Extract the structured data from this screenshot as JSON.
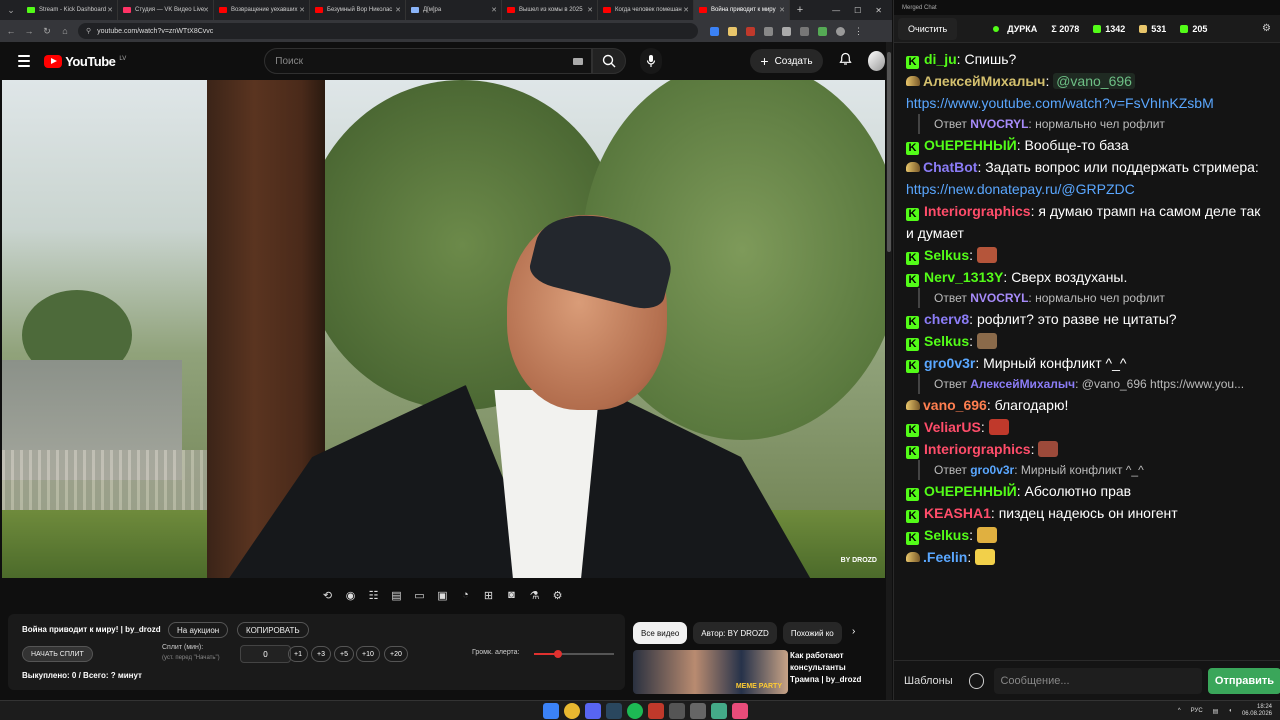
{
  "browser": {
    "tabs": [
      {
        "label": "Stream - Kick Dashboard",
        "color": "#53fc18"
      },
      {
        "label": "Студия — VK Видео Live",
        "color": "#ff3366"
      },
      {
        "label": "Возвращение уехавших",
        "color": "#ff0000"
      },
      {
        "label": "Безумный Вор Николас",
        "color": "#ff0000"
      },
      {
        "label": "Д[м]ра",
        "color": "#8ab4f8"
      },
      {
        "label": "Вышел из комы в 2025",
        "color": "#ff0000"
      },
      {
        "label": "Когда человек помешан",
        "color": "#ff0000"
      },
      {
        "label": "Война приводит к миру",
        "color": "#ff0000",
        "active": true
      }
    ],
    "url": "youtube.com/watch?v=znWTtX8Cvvc"
  },
  "youtube": {
    "logo_text": "YouTube",
    "region": "LV",
    "search_placeholder": "Поиск",
    "create_label": "Создать"
  },
  "player_panel": {
    "title": "Война приводит к миру! | by_drozd",
    "auction_label": "На аукцион",
    "copy_label": "КОПИРОВАТЬ",
    "start_split_label": "НАЧАТЬ СПЛИТ",
    "split_label": "Сплит (мин):",
    "split_hint": "(уст. перед \"Начать\")",
    "split_value": "0",
    "increments": [
      "+1",
      "+3",
      "+5",
      "+10",
      "+20"
    ],
    "alert_volume_label": "Громк. алерта:",
    "alert_volume_fraction": 0.3,
    "bought_text": "Выкуплено: 0 / Всего: ? минут"
  },
  "related": {
    "chips": [
      "Все видео",
      "Автор: BY DROZD",
      "Похожий ко"
    ],
    "video_title": "Как работают консультанты Трампа | by_drozd",
    "thumb_badge": "MEME PARTY",
    "video_watermark": "BY DROZD"
  },
  "chat": {
    "window_title": "Merged Chat",
    "clear_label": "Очистить",
    "channel": "ДУРКА",
    "stats": [
      {
        "value": "Σ 2078",
        "color": "#ffffff"
      },
      {
        "value": "1342",
        "color": "#53fc18"
      },
      {
        "value": "531",
        "color": "#e8c56a"
      },
      {
        "value": "205",
        "color": "#53fc18"
      }
    ],
    "messages": [
      {
        "badge": "k",
        "user": "di_ju",
        "color": "#53fc18",
        "text": "Спишь?"
      },
      {
        "badge": "b",
        "user": "АлексейМихалыч",
        "color": "#d4c06e",
        "mention": "@vano_696",
        "link": "https://www.youtube.com/watch?v=FsVhInKZsbM"
      },
      {
        "reply": true,
        "prefix": "Ответ",
        "user": "NVOCRYL",
        "color": "#a78bfa",
        "text": "нормально чел рофлит"
      },
      {
        "badge": "k",
        "user": "ОЧЕРЕННЫЙ",
        "color": "#53fc18",
        "text": "Вообще-то база"
      },
      {
        "badge": "b",
        "user": "ChatBot",
        "color": "#8b7cf6",
        "text": "Задать вопрос или поддержать стримера:",
        "link": "https://new.donatepay.ru/@GRPZDC"
      },
      {
        "badge": "k",
        "user": "Interiorgraphics",
        "color": "#ff4d6a",
        "text": "я думаю трамп на самом деле так и думает"
      },
      {
        "badge": "k",
        "user": "Selkus",
        "color": "#53fc18",
        "emote": "#b5553a"
      },
      {
        "badge": "k",
        "user": "Nerv_1313Y",
        "color": "#53fc18",
        "text": "Сверх воздуханы."
      },
      {
        "reply": true,
        "prefix": "Ответ",
        "user": "NVOCRYL",
        "color": "#a78bfa",
        "text": "нормально чел рофлит"
      },
      {
        "badge": "k",
        "user": "cherv8",
        "color": "#8b7cf6",
        "text": "рофлит? это разве не цитаты?"
      },
      {
        "badge": "k",
        "user": "Selkus",
        "color": "#53fc18",
        "emote": "#8a6a4a"
      },
      {
        "badge": "k",
        "user": "gro0v3r",
        "color": "#5aa7ff",
        "text": "Мирный конфликт ^_^"
      },
      {
        "reply": true,
        "prefix": "Ответ",
        "user": "АлексейМихалыч",
        "color": "#8b7cf6",
        "text": "@vano_696 https://www.you..."
      },
      {
        "badge": "b",
        "user": "vano_696",
        "color": "#ff7f50",
        "text": "благодарю!"
      },
      {
        "badge": "k",
        "user": "VeliarUS",
        "color": "#ff4d6a",
        "emote": "#c0392b"
      },
      {
        "badge": "k",
        "user": "Interiorgraphics",
        "color": "#ff4d6a",
        "emote": "#9c4a3a"
      },
      {
        "reply": true,
        "prefix": "Ответ",
        "user": "gro0v3r",
        "color": "#5aa7ff",
        "text": "Мирный конфликт ^_^"
      },
      {
        "badge": "k",
        "user": "ОЧЕРЕННЫЙ",
        "color": "#53fc18",
        "text": "Абсолютно прав"
      },
      {
        "badge": "k",
        "user": "KEASHA1",
        "color": "#ff4d6a",
        "text": "пиздец надеюсь он иногент"
      },
      {
        "badge": "k",
        "user": "Selkus",
        "color": "#53fc18",
        "emote": "#e0b040"
      },
      {
        "badge": "b",
        "user": ".Feelin",
        "color": "#5aa7ff",
        "emote": "#f2d04a"
      }
    ],
    "templates_label": "Шаблоны",
    "input_placeholder": "Сообщение...",
    "send_label": "Отправить"
  },
  "taskbar": {
    "lang": "РУС",
    "time": "18:24",
    "date": "06.08.2026"
  }
}
